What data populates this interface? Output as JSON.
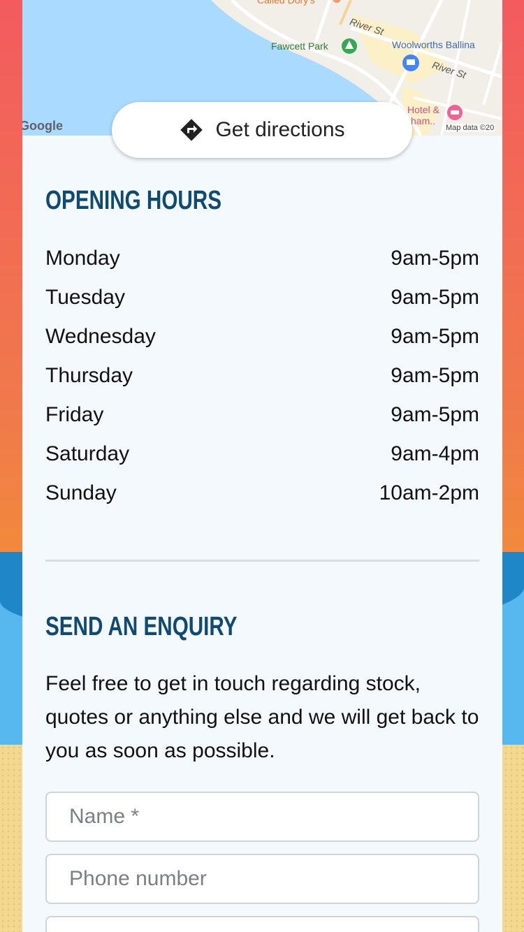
{
  "map": {
    "labels": {
      "called_dorys": "Called Dory's",
      "river_st_1": "River St",
      "fawcett_park": "Fawcett Park",
      "woolworths": "Woolworths Ballina",
      "river_st_2": "River St",
      "hotel": "Hotel &",
      "hotel_2": "ham..",
      "google": "Google",
      "map_data": "Map data ©20"
    }
  },
  "directions": {
    "label": "Get directions",
    "icon": "directions-icon"
  },
  "hours": {
    "title": "OPENING HOURS",
    "rows": [
      {
        "day": "Monday",
        "time": "9am-5pm"
      },
      {
        "day": "Tuesday",
        "time": "9am-5pm"
      },
      {
        "day": "Wednesday",
        "time": "9am-5pm"
      },
      {
        "day": "Thursday",
        "time": "9am-5pm"
      },
      {
        "day": "Friday",
        "time": "9am-5pm"
      },
      {
        "day": "Saturday",
        "time": "9am-4pm"
      },
      {
        "day": "Sunday",
        "time": "10am-2pm"
      }
    ]
  },
  "enquiry": {
    "title": "SEND AN ENQUIRY",
    "intro": "Feel free to get in touch regarding stock, quotes or anything else and we will get back to you as soon as possible.",
    "name_placeholder": "Name *",
    "phone_placeholder": "Phone number",
    "email_placeholder": ""
  },
  "colors": {
    "title": "#0f4a73",
    "card": "#f4f9fd",
    "water": "#aadaff",
    "background_top": "#f35b5f",
    "background_orange": "#f28a3c",
    "wave": "#56b8ef",
    "sand": "#f3d98f"
  }
}
